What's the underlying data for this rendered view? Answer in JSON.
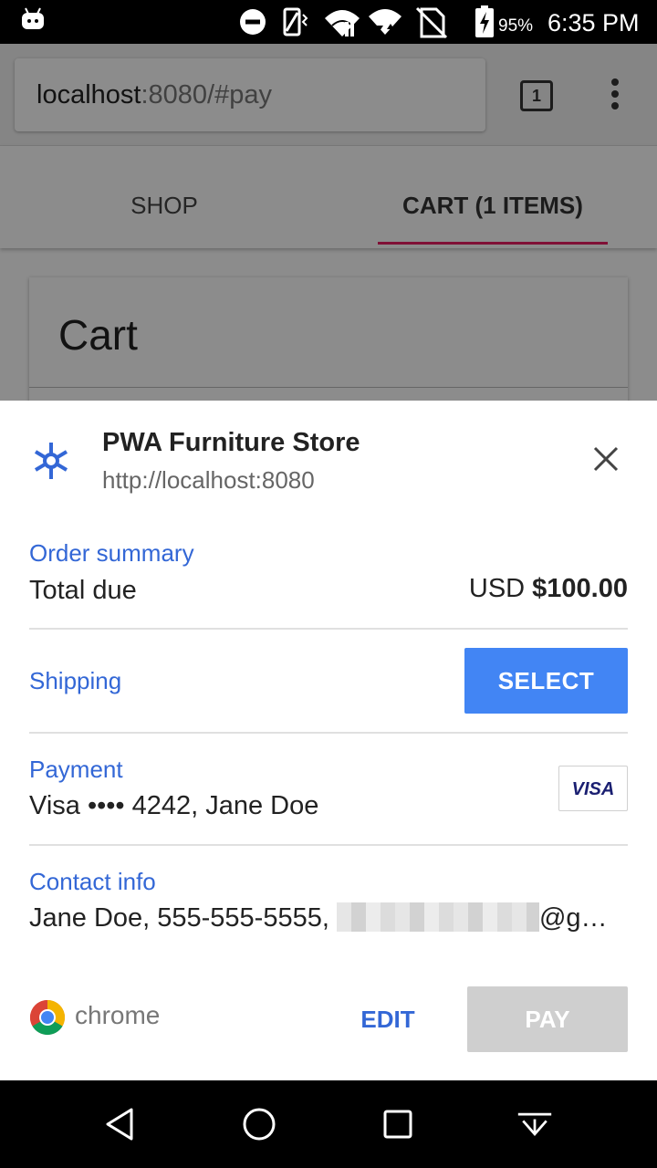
{
  "status_bar": {
    "battery_percent": "95%",
    "time": "6:35 PM",
    "icons": [
      "android-icon",
      "do-not-disturb-icon",
      "vibrate-icon",
      "signal-icon",
      "wifi-icon",
      "no-sim-icon",
      "battery-charging-icon"
    ]
  },
  "browser": {
    "url_host": "localhost",
    "url_rest": ":8080/#pay",
    "tab_count": "1"
  },
  "page": {
    "tabs": [
      {
        "label": "SHOP",
        "selected": false
      },
      {
        "label": "CART (1 ITEMS)",
        "selected": true
      }
    ],
    "card_title": "Cart"
  },
  "payment_sheet": {
    "merchant_name": "PWA Furniture Store",
    "merchant_url": "http://localhost:8080",
    "order_summary": {
      "label": "Order summary",
      "total_label": "Total due",
      "currency": "USD",
      "amount": "$100.00"
    },
    "shipping": {
      "label": "Shipping",
      "button": "SELECT"
    },
    "payment": {
      "label": "Payment",
      "value": "Visa  •••• 4242, Jane Doe",
      "card_brand": "VISA"
    },
    "contact": {
      "label": "Contact info",
      "value_prefix": "Jane Doe, 555-555-5555, ",
      "value_suffix": "@g…"
    },
    "footer": {
      "brand": "chrome",
      "edit": "EDIT",
      "pay": "PAY"
    }
  },
  "colors": {
    "accent_blue": "#4285f4",
    "link_blue": "#3367d6",
    "tab_underline": "#e91e63",
    "disabled_button": "#cfcfcf"
  }
}
